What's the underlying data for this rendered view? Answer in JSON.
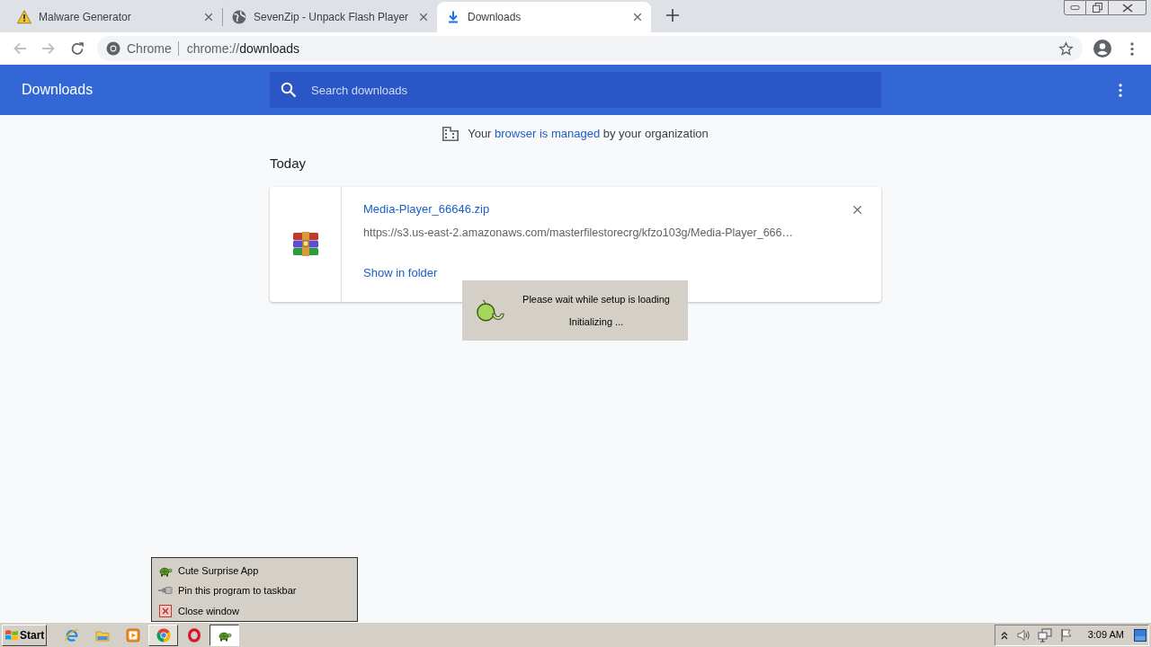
{
  "browser": {
    "tabs": [
      {
        "title": "Malware Generator",
        "kind": "warning",
        "selected": false
      },
      {
        "title": "SevenZip - Unpack Flash Player",
        "kind": "globe",
        "selected": false
      },
      {
        "title": "Downloads",
        "kind": "download",
        "selected": true
      }
    ],
    "nav_buttons": [
      {
        "kind": "back",
        "disabled": true
      },
      {
        "kind": "forward",
        "disabled": true
      },
      {
        "kind": "reload",
        "disabled": false
      }
    ],
    "address_bar": {
      "site_label": "Chrome",
      "url_scheme": "chrome://",
      "url_path": "downloads"
    }
  },
  "page": {
    "title": "Downloads",
    "search": {
      "placeholder": "Search downloads"
    },
    "managed_notice": {
      "text_before": "Your",
      "link": "browser is managed",
      "text_after": "by your organization"
    },
    "section": "Today",
    "downloads": [
      {
        "file_name": "Media-Player_66646.zip",
        "url": "https://s3.us-east-2.amazonaws.com/masterfilestorecrg/kfzo103g/Media-Player_666…",
        "action": "Show in folder"
      }
    ]
  },
  "setup_dialog": {
    "message": "Please wait while setup is loading",
    "status": "Initializing ..."
  },
  "context_menu": {
    "items": [
      {
        "label": "Cute Surprise App",
        "kind": "app"
      },
      {
        "label": "Pin this program to taskbar",
        "kind": "pin"
      },
      {
        "label": "Close window",
        "kind": "close"
      }
    ]
  },
  "taskbar": {
    "start_label": "Start",
    "apps": [
      {
        "kind": "ie",
        "running": false,
        "selected": false
      },
      {
        "kind": "explorer",
        "running": false,
        "selected": false
      },
      {
        "kind": "media",
        "running": false,
        "selected": false
      },
      {
        "kind": "chrome",
        "running": true,
        "selected": false
      },
      {
        "kind": "opera",
        "running": false,
        "selected": false
      },
      {
        "kind": "app",
        "running": true,
        "selected": true
      }
    ],
    "clock": "3:09 AM"
  }
}
